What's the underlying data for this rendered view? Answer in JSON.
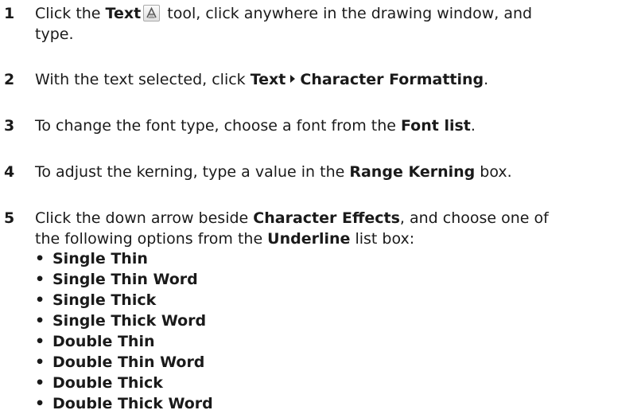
{
  "steps": [
    {
      "number": "1",
      "parts": {
        "a": "Click the ",
        "b": "Text",
        "c": " tool, click anywhere in the drawing window, and",
        "d": "type."
      },
      "icon": "text-tool-icon"
    },
    {
      "number": "2",
      "parts": {
        "a": "With the text selected, click ",
        "b": "Text",
        "c": "Character Formatting",
        "d": "."
      },
      "icon": "submenu-arrow-icon"
    },
    {
      "number": "3",
      "parts": {
        "a": "To change the font type, choose a font from the ",
        "b": "Font list",
        "c": "."
      }
    },
    {
      "number": "4",
      "parts": {
        "a": "To adjust the kerning, type a value in the ",
        "b": "Range Kerning",
        "c": " box."
      }
    },
    {
      "number": "5",
      "parts": {
        "a": "Click the down arrow beside ",
        "b": "Character Effects",
        "c": ", and choose one of",
        "d": "the following options from the ",
        "e": "Underline",
        "f": " list box:"
      }
    }
  ],
  "bullet_char": "•",
  "underline_options": [
    "Single Thin",
    "Single Thin Word",
    "Single Thick",
    "Single Thick Word",
    "Double Thin",
    "Double Thin Word",
    "Double Thick",
    "Double Thick Word"
  ]
}
